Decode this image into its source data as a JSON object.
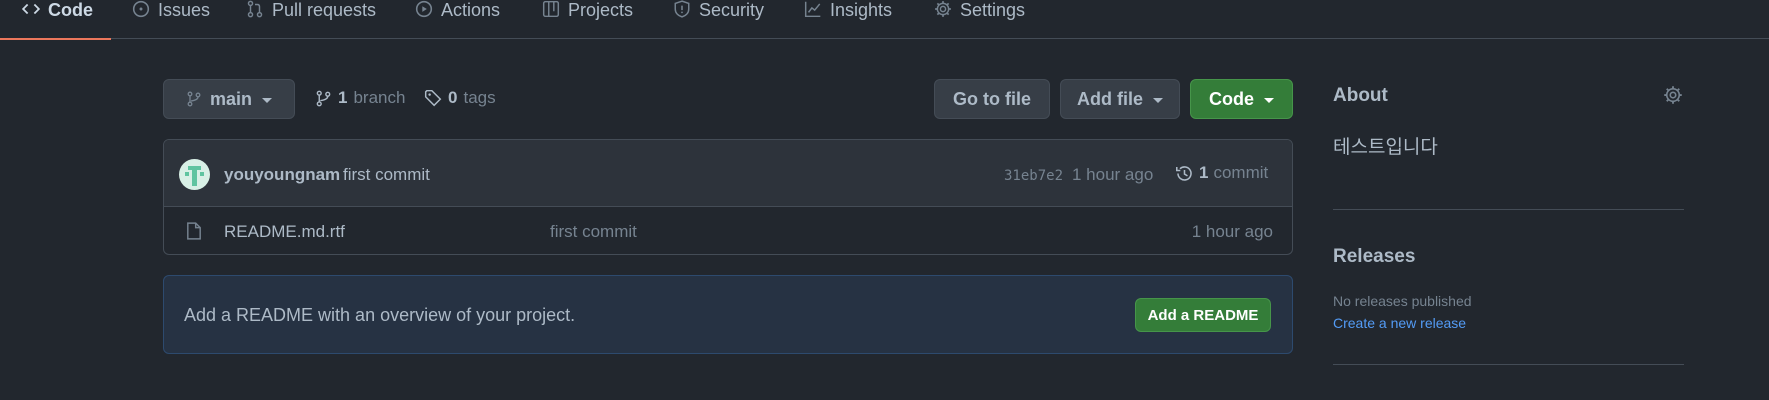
{
  "nav": {
    "tabs": [
      {
        "label": "Code",
        "icon": "code-icon"
      },
      {
        "label": "Issues",
        "icon": "issue-icon"
      },
      {
        "label": "Pull requests",
        "icon": "pull-request-icon"
      },
      {
        "label": "Actions",
        "icon": "play-icon"
      },
      {
        "label": "Projects",
        "icon": "table-icon"
      },
      {
        "label": "Security",
        "icon": "shield-icon"
      },
      {
        "label": "Insights",
        "icon": "graph-icon"
      },
      {
        "label": "Settings",
        "icon": "gear-icon"
      }
    ],
    "active": "Code"
  },
  "toolbar": {
    "branch_name": "main",
    "branch_count": "1",
    "branch_word": "branch",
    "tag_count": "0",
    "tag_word": "tags",
    "go_to_file": "Go to file",
    "add_file": "Add file",
    "code": "Code"
  },
  "latest_commit": {
    "author": "youyoungnam",
    "message": "first commit",
    "sha": "31eb7e2",
    "time": "1 hour ago",
    "commit_count": "1",
    "commit_word": "commit"
  },
  "files": [
    {
      "name": "README.md.rtf",
      "message": "first commit",
      "time": "1 hour ago"
    }
  ],
  "readme_banner": {
    "text": "Add a README with an overview of your project.",
    "button": "Add a README"
  },
  "sidebar": {
    "about_title": "About",
    "description": "테스트입니다",
    "releases_title": "Releases",
    "no_releases": "No releases published",
    "create_release": "Create a new release"
  },
  "colors": {
    "background": "#22272e",
    "accent_underline": "#ec775c",
    "green_button": "#347d39",
    "link": "#539bf5"
  }
}
